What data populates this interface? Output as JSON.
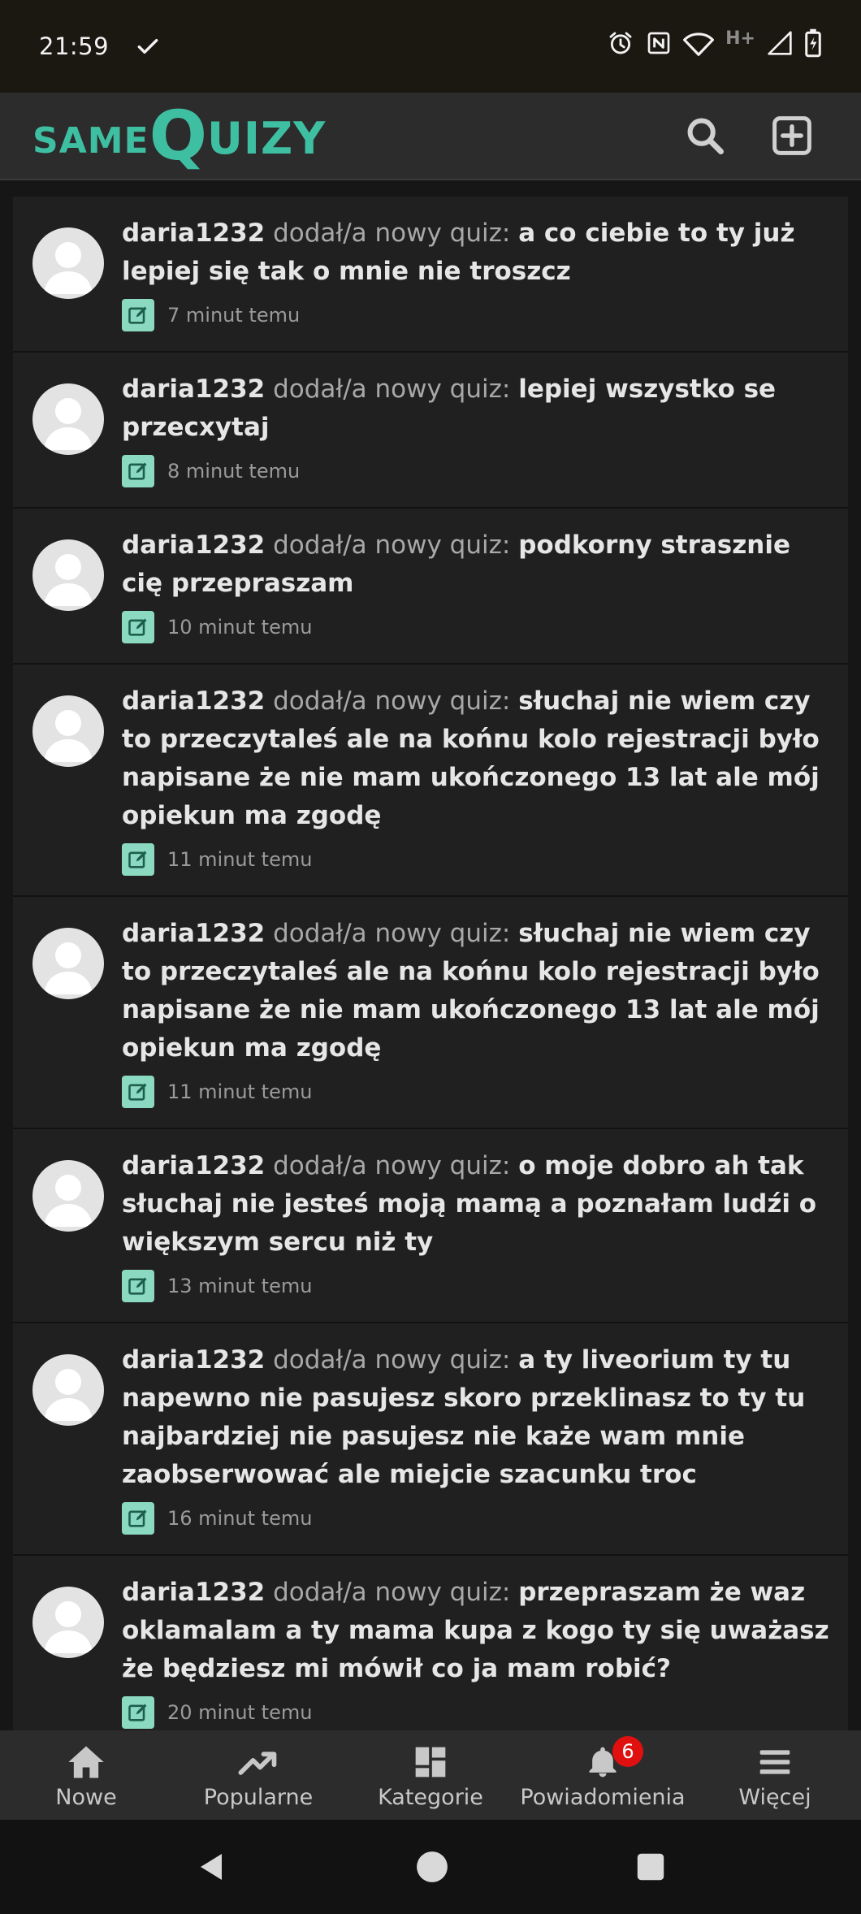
{
  "status_bar": {
    "time": "21:59",
    "network_label": "H+",
    "icons": [
      "check-icon",
      "alarm-icon",
      "nfc-icon",
      "wifi-icon",
      "signal-icon",
      "battery-charging-icon"
    ]
  },
  "header": {
    "logo_part1": "SAME",
    "logo_part2": "Q",
    "logo_part3": "UIZY",
    "brand_color": "#3fbfa2",
    "icons": [
      "search-icon",
      "add-box-icon"
    ]
  },
  "feed": {
    "items": [
      {
        "user": "daria1232",
        "action": "dodał/a nowy quiz:",
        "title": "a co ciebie to ty już lepiej się tak o mnie nie troszcz",
        "time": "7 minut temu"
      },
      {
        "user": "daria1232",
        "action": "dodał/a nowy quiz:",
        "title": "lepiej wszystko se przecxytaj",
        "time": "8 minut temu"
      },
      {
        "user": "daria1232",
        "action": "dodał/a nowy quiz:",
        "title": "podkorny strasznie cię przepraszam",
        "time": "10 minut temu"
      },
      {
        "user": "daria1232",
        "action": "dodał/a nowy quiz:",
        "title": "słuchaj nie wiem czy to przeczytaleś ale na końnu kolo rejestracji było napisane że nie mam ukończonego 13 lat ale mój opiekun ma zgodę",
        "time": "11 minut temu"
      },
      {
        "user": "daria1232",
        "action": "dodał/a nowy quiz:",
        "title": "słuchaj nie wiem czy to przeczytaleś ale na końnu kolo rejestracji było napisane że nie mam ukończonego 13 lat ale mój opiekun ma zgodę",
        "time": "11 minut temu"
      },
      {
        "user": "daria1232",
        "action": "dodał/a nowy quiz:",
        "title": "o moje dobro ah tak słuchaj nie jesteś moją mamą a poznałam ludźi o większym sercu niż ty",
        "time": "13 minut temu"
      },
      {
        "user": "daria1232",
        "action": "dodał/a nowy quiz:",
        "title": "a ty liveorium ty tu napewno nie pasujesz skoro przeklinasz to ty tu najbardziej nie pasujesz nie każe wam mnie zaobserwować ale miejcie szacunku troc",
        "time": "16 minut temu"
      },
      {
        "user": "daria1232",
        "action": "dodał/a nowy quiz:",
        "title": "przepraszam że waz oklamalam a ty mama kupa z kogo ty się uważasz że będziesz mi mówił co ja mam robić?",
        "time": "20 minut temu"
      }
    ]
  },
  "bottom_nav": {
    "items": [
      {
        "label": "Nowe",
        "icon": "home-icon"
      },
      {
        "label": "Popularne",
        "icon": "trending-icon"
      },
      {
        "label": "Kategorie",
        "icon": "dashboard-icon"
      },
      {
        "label": "Powiadomienia",
        "icon": "bell-icon",
        "badge": "6"
      },
      {
        "label": "Więcej",
        "icon": "menu-icon"
      }
    ]
  },
  "system_nav": {
    "icons": [
      "back-icon",
      "home-circle-icon",
      "recents-icon"
    ]
  }
}
